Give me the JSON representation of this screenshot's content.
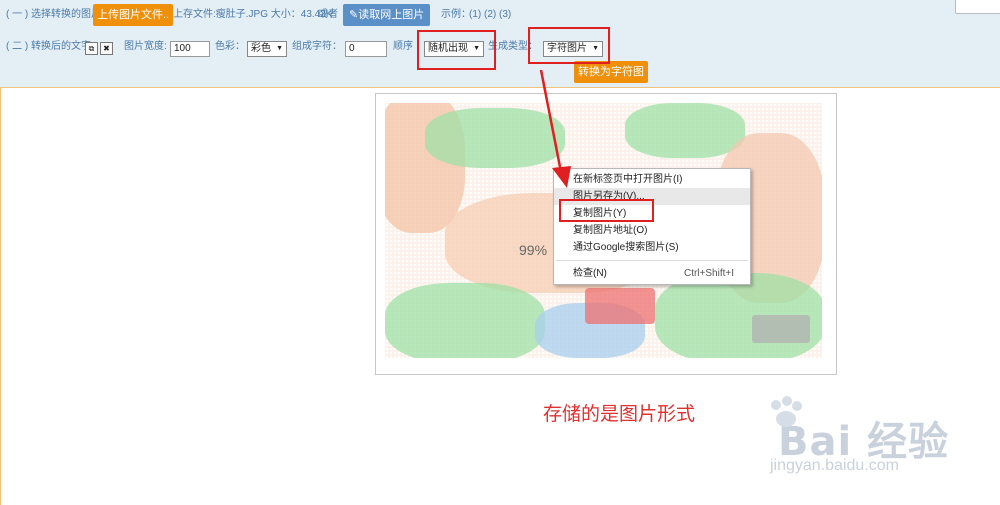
{
  "toolbar": {
    "row1": {
      "step_label": "( 一 ) 选择转换的图片:",
      "upload_button": "上传图片文件..",
      "upload_info": "上存文件:瘦肚子.JPG 大小：43.42K",
      "or_text": "或者",
      "read_web_button": "读取网上图片",
      "examples_label": "示例：",
      "examples_links": "(1) (2) (3)"
    },
    "row2": {
      "step_label": "( 二 ) 转换后的文字:",
      "width_label": "图片宽度:",
      "width_value": "100",
      "color_label": "色彩：",
      "color_value": "彩色",
      "chars_label": "组成字符：",
      "chars_value": "0",
      "order_label": "顺序",
      "order_value": "随机出现",
      "type_label": "生成类型：",
      "type_value": "字符图片",
      "convert_button": "转换为字符图"
    }
  },
  "preview": {
    "progress_text": "99%"
  },
  "context_menu": {
    "items": [
      {
        "label": "在新标签页中打开图片(I)",
        "shortcut": ""
      },
      {
        "label": "图片另存为(V)...",
        "shortcut": ""
      },
      {
        "label": "复制图片(Y)",
        "shortcut": ""
      },
      {
        "label": "复制图片地址(O)",
        "shortcut": ""
      },
      {
        "label": "通过Google搜索图片(S)",
        "shortcut": ""
      },
      {
        "label": "检查(N)",
        "shortcut": "Ctrl+Shift+I"
      }
    ]
  },
  "caption": "存储的是图片形式",
  "watermark": {
    "logo": "Bai 经验",
    "url": "jingyan.baidu.com"
  },
  "colors": {
    "toolbar_bg": "#e4eef5",
    "orange_button": "#f0900a",
    "blue_button": "#5b8fc7",
    "annotation_red": "#e02020"
  }
}
